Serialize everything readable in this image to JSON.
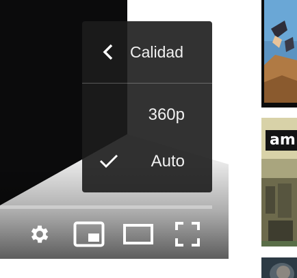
{
  "player": {
    "quality_menu": {
      "title": "Calidad",
      "options": [
        {
          "label": "360p",
          "selected": false
        },
        {
          "label": "Auto",
          "selected": true
        }
      ]
    },
    "controls": [
      {
        "icon": "gear-icon",
        "action": "settings"
      },
      {
        "icon": "miniplayer-icon",
        "action": "miniplayer"
      },
      {
        "icon": "theater-mode-icon",
        "action": "theater"
      },
      {
        "icon": "fullscreen-icon",
        "action": "fullscreen"
      }
    ]
  },
  "sidebar": {
    "thumbnails": [
      {
        "badge": ""
      },
      {
        "badge": "am"
      },
      {
        "badge": ""
      }
    ]
  },
  "colors": {
    "menu_background": "#1c1c1c",
    "menu_text": "#f1f1f1",
    "thumb_frame": "#0c0c0c"
  }
}
